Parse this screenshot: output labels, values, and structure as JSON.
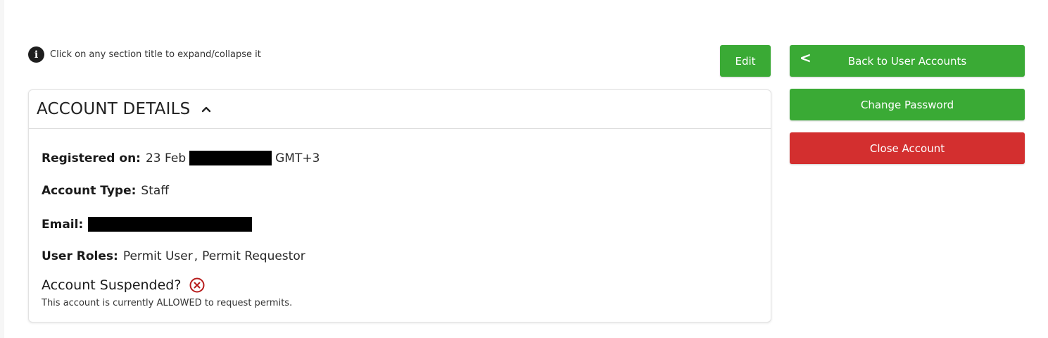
{
  "hint": {
    "icon": "info-icon",
    "glyph": "i",
    "text": "Click on any section title to expand/collapse it"
  },
  "actions": {
    "edit_label": "Edit",
    "back_label": "Back to User Accounts",
    "back_icon": "chevron-left-icon",
    "back_glyph": "<",
    "change_password_label": "Change Password",
    "close_account_label": "Close Account",
    "primary_color": "#3aaa35",
    "danger_color": "#d32f2f"
  },
  "account_details": {
    "title": "ACCOUNT DETAILS",
    "toggle_icon": "chevron-up-icon",
    "registered_on": {
      "label": "Registered on:",
      "date_prefix": "23 Feb",
      "timezone": "GMT+3"
    },
    "account_type": {
      "label": "Account Type:",
      "value": "Staff"
    },
    "email": {
      "label": "Email:"
    },
    "user_roles": {
      "label": "User Roles:",
      "roles": [
        "Permit User",
        "Permit Requestor"
      ],
      "separator": ","
    },
    "suspended": {
      "label": "Account Suspended?",
      "status_icon": "circle-x-icon",
      "status_color": "#b71c1c",
      "note": "This account is currently ALLOWED to request permits."
    }
  }
}
